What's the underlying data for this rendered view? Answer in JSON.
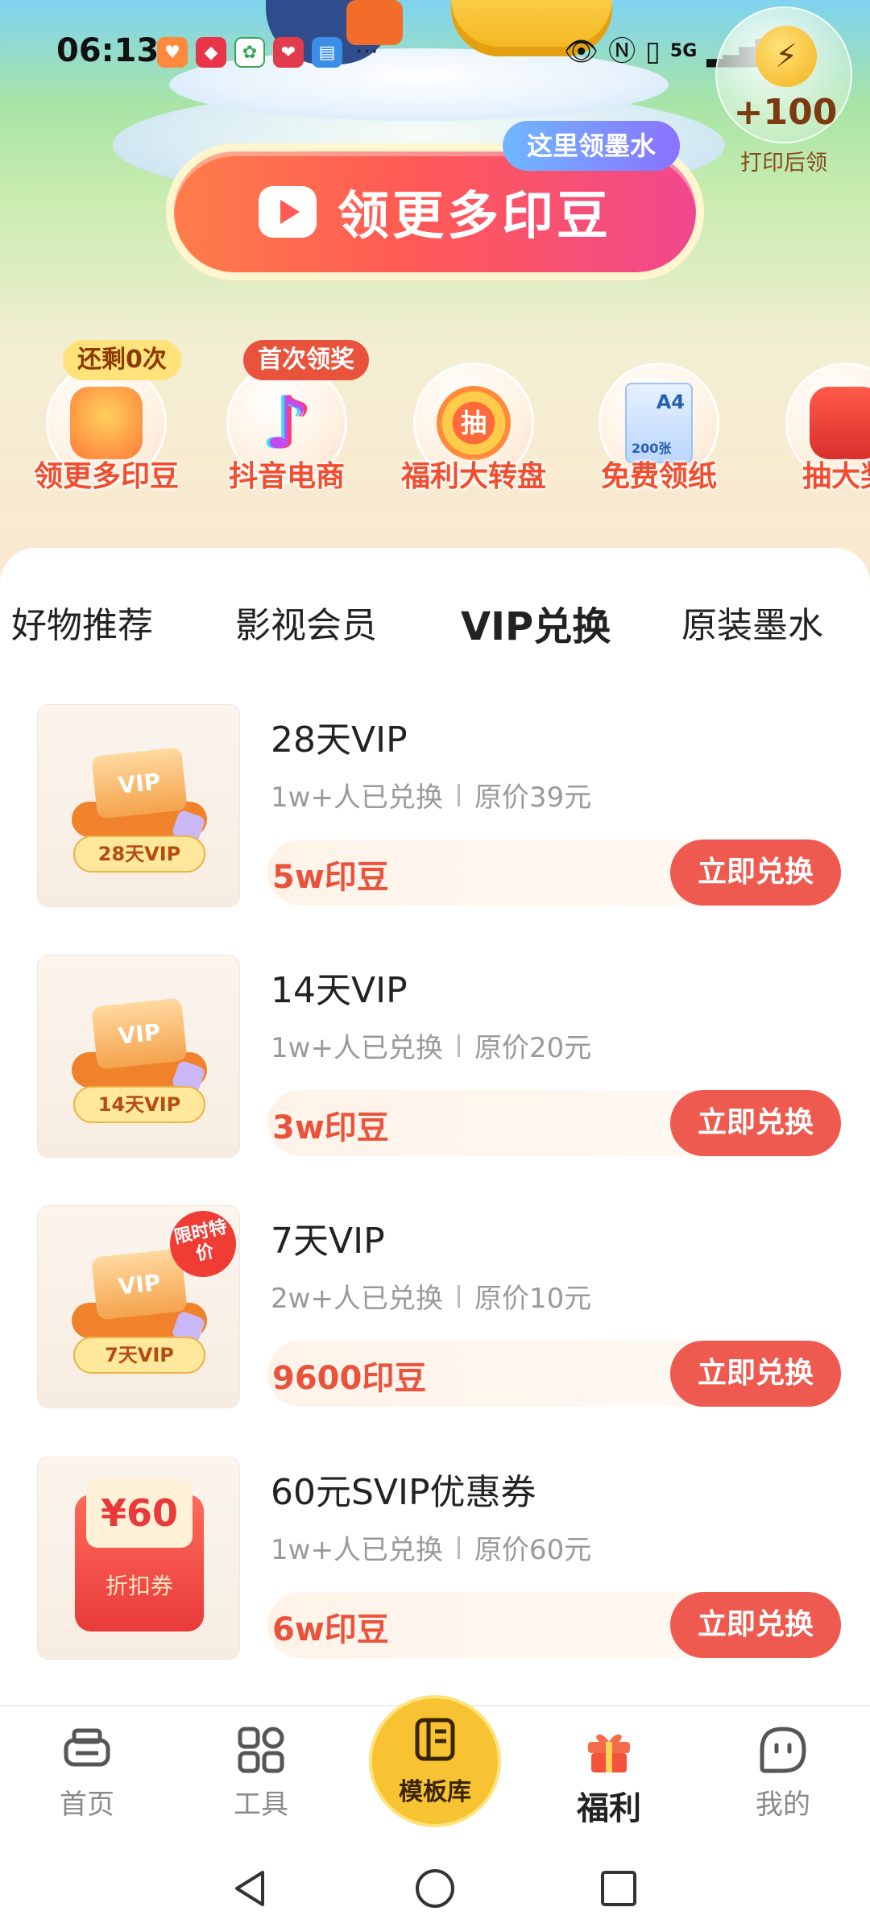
{
  "status_bar": {
    "time": "06:13",
    "signal_text": "5G"
  },
  "hero": {
    "bonus_amount": "+100",
    "bonus_caption": "打印后领",
    "cta_label": "领更多印豆",
    "ink_tag": "这里领墨水"
  },
  "shortcuts": [
    {
      "label": "领更多印豆",
      "badge": "还剩0次",
      "icon": "gift-box-icon"
    },
    {
      "label": "抖音电商",
      "badge": "首次领奖",
      "icon": "douyin-icon"
    },
    {
      "label": "福利大转盘",
      "badge": "",
      "icon": "lucky-wheel-icon",
      "center_text": "抽"
    },
    {
      "label": "免费领纸",
      "badge": "",
      "icon": "paper-icon",
      "center_text": "A4",
      "sub_text": "200张"
    },
    {
      "label": "抽大奖",
      "badge": "",
      "icon": "prize-gift-icon"
    }
  ],
  "tabs": [
    {
      "label": "好物推荐",
      "active": false
    },
    {
      "label": "影视会员",
      "active": false
    },
    {
      "label": "VIP兑换",
      "active": true
    },
    {
      "label": "原装墨水",
      "active": false
    }
  ],
  "items": [
    {
      "title": "28天VIP",
      "redeemed": "1w+人已兑换",
      "original_price": "原价39元",
      "price": "5w印豆",
      "button": "立即兑换",
      "thumb_pill": "28天VIP",
      "thumb_card": "VIP"
    },
    {
      "title": "14天VIP",
      "redeemed": "1w+人已兑换",
      "original_price": "原价20元",
      "price": "3w印豆",
      "button": "立即兑换",
      "thumb_pill": "14天VIP",
      "thumb_card": "VIP"
    },
    {
      "title": "7天VIP",
      "redeemed": "2w+人已兑换",
      "original_price": "原价10元",
      "price": "9600印豆",
      "button": "立即兑换",
      "thumb_pill": "7天VIP",
      "thumb_card": "VIP",
      "thumb_badge": "限时特价"
    },
    {
      "title": "60元SVIP优惠券",
      "redeemed": "1w+人已兑换",
      "original_price": "原价60元",
      "price": "6w印豆",
      "button": "立即兑换",
      "thumb_amount": "¥60",
      "thumb_caption": "折扣券"
    }
  ],
  "bottom_nav": [
    {
      "label": "首页",
      "icon": "printer-icon",
      "active": false
    },
    {
      "label": "工具",
      "icon": "grid-icon",
      "active": false
    },
    {
      "label": "模板库",
      "icon": "template-icon",
      "active": false
    },
    {
      "label": "福利",
      "icon": "gift-icon",
      "active": true
    },
    {
      "label": "我的",
      "icon": "profile-face-icon",
      "active": false
    }
  ],
  "colors": {
    "accent_red": "#ee5a4f",
    "price_red": "#e9533c",
    "center_yellow": "#f7c333"
  }
}
